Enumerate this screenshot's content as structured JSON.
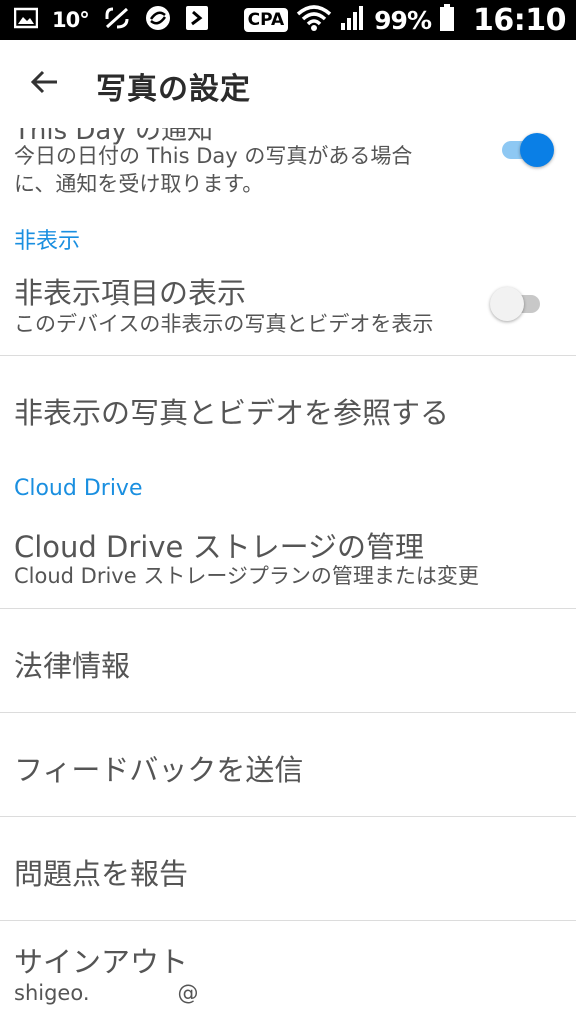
{
  "status_bar": {
    "temperature": "10°",
    "carrier_badge": "CPA",
    "battery_percent": "99%",
    "time": "16:10",
    "icons": [
      "gallery-icon",
      "temperature-text",
      "nav-icon",
      "sync-icon",
      "photo-app-icon",
      "wifi-icon",
      "signal-icon",
      "battery-icon"
    ]
  },
  "header": {
    "title": "写真の設定",
    "back_icon": "arrow-left-icon"
  },
  "settings": {
    "this_day": {
      "title_partial": "This Day の通知",
      "subtitle_line1": "今日の日付の This Day の写真がある場合",
      "subtitle_line2": "に、通知を受け取ります。",
      "enabled": true
    },
    "hidden_section": {
      "header": "非表示",
      "show_hidden": {
        "title": "非表示項目の表示",
        "subtitle": "このデバイスの非表示の写真とビデオを表示",
        "enabled": false
      },
      "browse_hidden": {
        "title": "非表示の写真とビデオを参照する"
      }
    },
    "cloud_section": {
      "header": "Cloud Drive",
      "manage_storage": {
        "title": "Cloud Drive ストレージの管理",
        "subtitle": "Cloud Drive ストレージプランの管理または変更"
      }
    },
    "legal": {
      "title": "法律情報"
    },
    "feedback": {
      "title": "フィードバックを送信"
    },
    "report": {
      "title": "問題点を報告"
    },
    "sign_out": {
      "title": "サインアウト",
      "account_prefix": "shigeo.",
      "account_suffix": "@"
    }
  },
  "colors": {
    "accent": "#1a8fe0",
    "toggle_on": "#0a7fe6",
    "divider": "#dcdcdc"
  }
}
